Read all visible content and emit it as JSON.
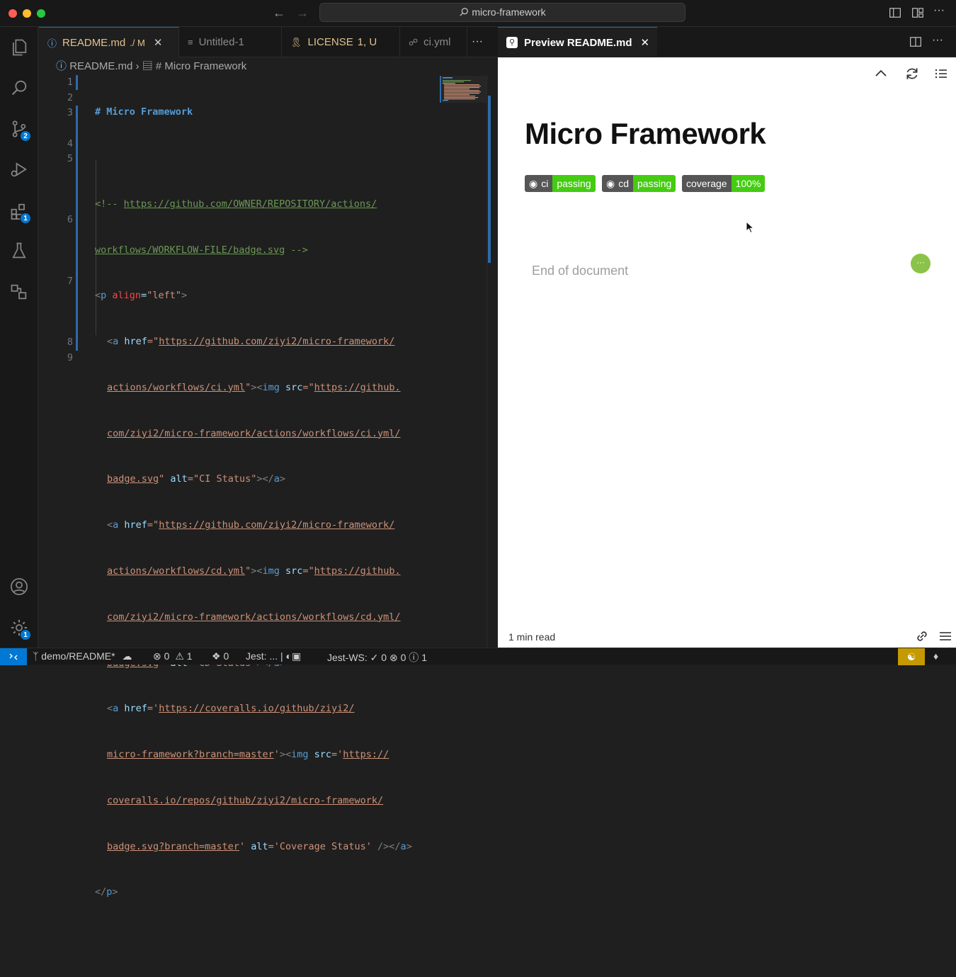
{
  "window": {
    "search_text": "micro-framework"
  },
  "activity_bar": {
    "source_control_badge": "2",
    "extensions_badge": "1",
    "settings_badge": "1"
  },
  "tabs": [
    {
      "label": "README.md",
      "suffix": "./ M"
    },
    {
      "label": "Untitled-1"
    },
    {
      "label": "LICENSE",
      "suffix": "1, U"
    },
    {
      "label": "ci.yml"
    }
  ],
  "breadcrumb": {
    "file": "README.md",
    "symbol": "# Micro Framework"
  },
  "editor": {
    "line_numbers": [
      "1",
      "2",
      "3",
      "4",
      "5",
      "6",
      "7",
      "8",
      "9"
    ],
    "lines": {
      "l1": "# Micro Framework",
      "l3a_pre": "<!-- ",
      "l3a_link": "https://github.com/OWNER/REPOSITORY/actions/",
      "l3b_link": "workflows/WORKFLOW-FILE/badge.svg",
      "l3b_post": " -->",
      "l4_open": "<",
      "l4_tag": "p",
      "l4_attr": " align",
      "l4_eq": "=",
      "l4_val": "\"left\"",
      "l4_close": ">",
      "l5a_open": "<",
      "l5a_tag": "a",
      "l5a_attr": " href",
      "l5a_eq": "=\"",
      "l5a_link": "https://github.com/ziyi2/micro-framework/",
      "l5b_link": "actions/workflows/ci.yml",
      "l5b_q": "\"",
      "l5b_gt": "><",
      "l5b_img": "img",
      "l5b_src": " src",
      "l5b_eq": "=\"",
      "l5b_link2": "https://github.",
      "l5c_link": "com/ziyi2/micro-framework/actions/workflows/ci.yml/",
      "l5d_link": "badge.svg",
      "l5d_q": "\"",
      "l5d_alt": " alt",
      "l5d_val": "=\"CI Status\"",
      "l5d_end": "></",
      "l5d_a": "a",
      "l5d_gt": ">",
      "l6a_link": "https://github.com/ziyi2/micro-framework/",
      "l6b_link": "actions/workflows/cd.yml",
      "l6b_link2": "https://github.",
      "l6c_link": "com/ziyi2/micro-framework/actions/workflows/cd.yml/",
      "l6d_link": "badge.svg",
      "l6d_val": "=\"CD Status\"",
      "l7a_eq": "='",
      "l7a_link": "https://coveralls.io/github/ziyi2/",
      "l7b_link": "micro-framework?branch=master",
      "l7b_q": "'",
      "l7b_eq": "='",
      "l7b_link2": "https://",
      "l7c_link": "coveralls.io/repos/github/ziyi2/micro-framework/",
      "l7d_link": "badge.svg?branch=master",
      "l7d_q": "'",
      "l7d_val": "='Coverage Status'",
      "l7d_end": " /></",
      "l8_open": "</",
      "l8_tag": "p",
      "l8_close": ">"
    }
  },
  "preview": {
    "tab_label": "Preview README.md",
    "title": "Micro Framework",
    "badges": [
      {
        "label": "ci",
        "value": "passing"
      },
      {
        "label": "cd",
        "value": "passing"
      },
      {
        "label": "coverage",
        "value": "100%"
      }
    ],
    "end_text": "End of document",
    "read_time": "1 min read",
    "dot_text": "···"
  },
  "statusbar": {
    "branch": "demo/README*",
    "errors": "0",
    "warnings": "1",
    "ports": "0",
    "jest": "Jest: ... |",
    "jest_ws_label": "Jest-WS:",
    "jest_ws_pass": "0",
    "jest_ws_fail": "0",
    "jest_ws_unknown": "1"
  },
  "colors": {
    "accent": "#0078d4",
    "badge_green": "#4c1",
    "badge_gray": "#555555",
    "untracked_yellow": "#e2c08d"
  }
}
